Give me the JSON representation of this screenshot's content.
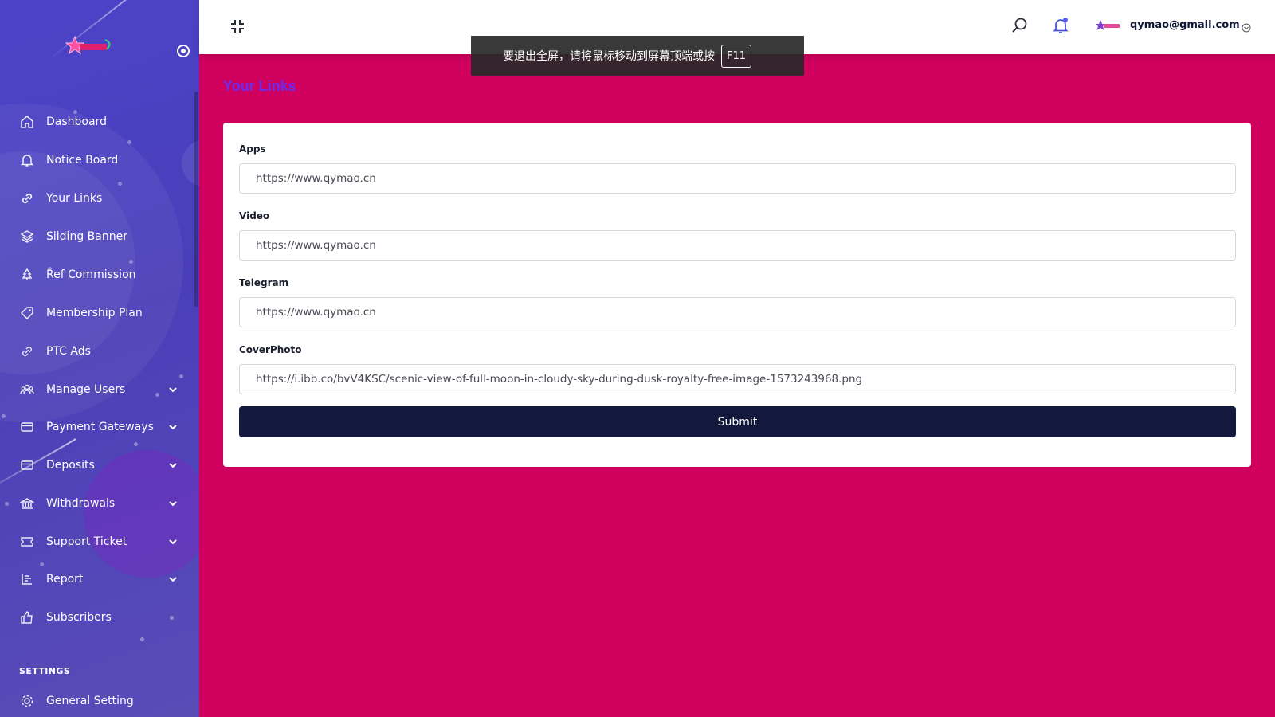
{
  "sidebar": {
    "logo_icon": "star-logo-icon",
    "items": [
      {
        "label": "Dashboard",
        "icon": "home-icon",
        "has_submenu": false
      },
      {
        "label": "Notice Board",
        "icon": "bell-icon",
        "has_submenu": false
      },
      {
        "label": "Your Links",
        "icon": "link-icon",
        "has_submenu": false
      },
      {
        "label": "Sliding Banner",
        "icon": "layers-icon",
        "has_submenu": false
      },
      {
        "label": "Ref Commission",
        "icon": "tree-icon",
        "has_submenu": false
      },
      {
        "label": "Membership Plan",
        "icon": "tag-icon",
        "has_submenu": false
      },
      {
        "label": "PTC Ads",
        "icon": "chain-icon",
        "has_submenu": false
      },
      {
        "label": "Manage Users",
        "icon": "users-icon",
        "has_submenu": true
      },
      {
        "label": "Payment Gateways",
        "icon": "card-icon",
        "has_submenu": true
      },
      {
        "label": "Deposits",
        "icon": "card-icon",
        "has_submenu": true
      },
      {
        "label": "Withdrawals",
        "icon": "bank-icon",
        "has_submenu": true
      },
      {
        "label": "Support Ticket",
        "icon": "ticket-icon",
        "has_submenu": true
      },
      {
        "label": "Report",
        "icon": "list-icon",
        "has_submenu": true
      },
      {
        "label": "Subscribers",
        "icon": "thumbs-up-icon",
        "has_submenu": false
      }
    ],
    "settings_title": "SETTINGS",
    "settings_items": [
      {
        "label": "General Setting",
        "icon": "gear-icon"
      }
    ]
  },
  "topbar": {
    "user_email": "qymao@gmail.com",
    "icons": [
      "exit-fullscreen-icon",
      "search-icon",
      "bell-icon",
      "avatar-icon",
      "chevron-down-icon"
    ]
  },
  "toast": {
    "message": "要退出全屏，请将鼠标移动到屏幕顶端或按",
    "key": "F11"
  },
  "page": {
    "title": "Your Links"
  },
  "form": {
    "apps_label": "Apps",
    "apps_value": "https://www.qymao.cn",
    "video_label": "Video",
    "video_value": "https://www.qymao.cn",
    "telegram_label": "Telegram",
    "telegram_value": "https://www.qymao.cn",
    "cover_label": "CoverPhoto",
    "cover_value": "https://i.ibb.co/bvV4KSC/scenic-view-of-full-moon-in-cloudy-sky-during-dusk-royalty-free-image-1573243968.png",
    "submit_label": "Submit"
  },
  "colors": {
    "sidebar_bg": "#4b43c9",
    "page_bg": "#d0005f",
    "title": "#6a2cf0",
    "submit_bg": "#12193d"
  }
}
